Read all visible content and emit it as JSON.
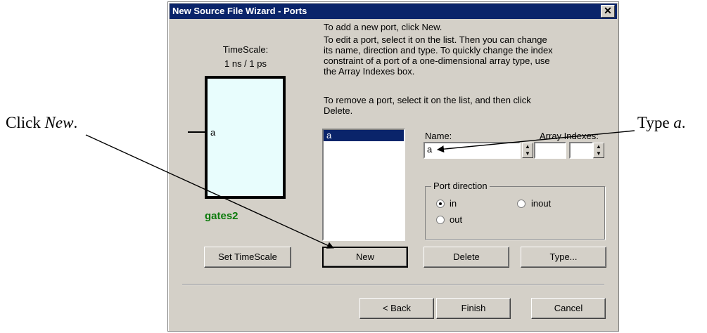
{
  "annotations": {
    "left_text": "Click ",
    "left_em": "New",
    "left_end": ".",
    "right_text": "Type ",
    "right_em": "a",
    "right_end": "."
  },
  "window": {
    "title": "New Source File Wizard - Ports",
    "close_glyph": "✕"
  },
  "left_panel": {
    "timescale_label": "TimeScale:",
    "timescale_value": "1 ns / 1 ps",
    "port_label": "a",
    "entity_name": "gates2",
    "set_timescale_button": "Set TimeScale"
  },
  "instructions": {
    "line1": "To add a new port, click New.",
    "line2a": "To edit a port, select it on the list. Then you can change",
    "line2b": "its name, direction and type. To quickly change the index",
    "line2c": "constraint of a port of a one-dimensional array type, use",
    "line2d": "the Array Indexes box.",
    "line3a": "To remove a port, select it on the list, and then click",
    "line3b": "Delete."
  },
  "port_list": {
    "items": [
      "a"
    ]
  },
  "name_field": {
    "label": "Name:",
    "value": "a"
  },
  "array_indexes": {
    "label": "Array Indexes:",
    "from": "",
    "to": ""
  },
  "port_direction": {
    "title": "Port direction",
    "options": [
      "in",
      "inout",
      "out"
    ],
    "selected": "in"
  },
  "buttons": {
    "new": "New",
    "delete": "Delete",
    "type": "Type...",
    "back": "< Back",
    "finish": "Finish",
    "cancel": "Cancel"
  }
}
